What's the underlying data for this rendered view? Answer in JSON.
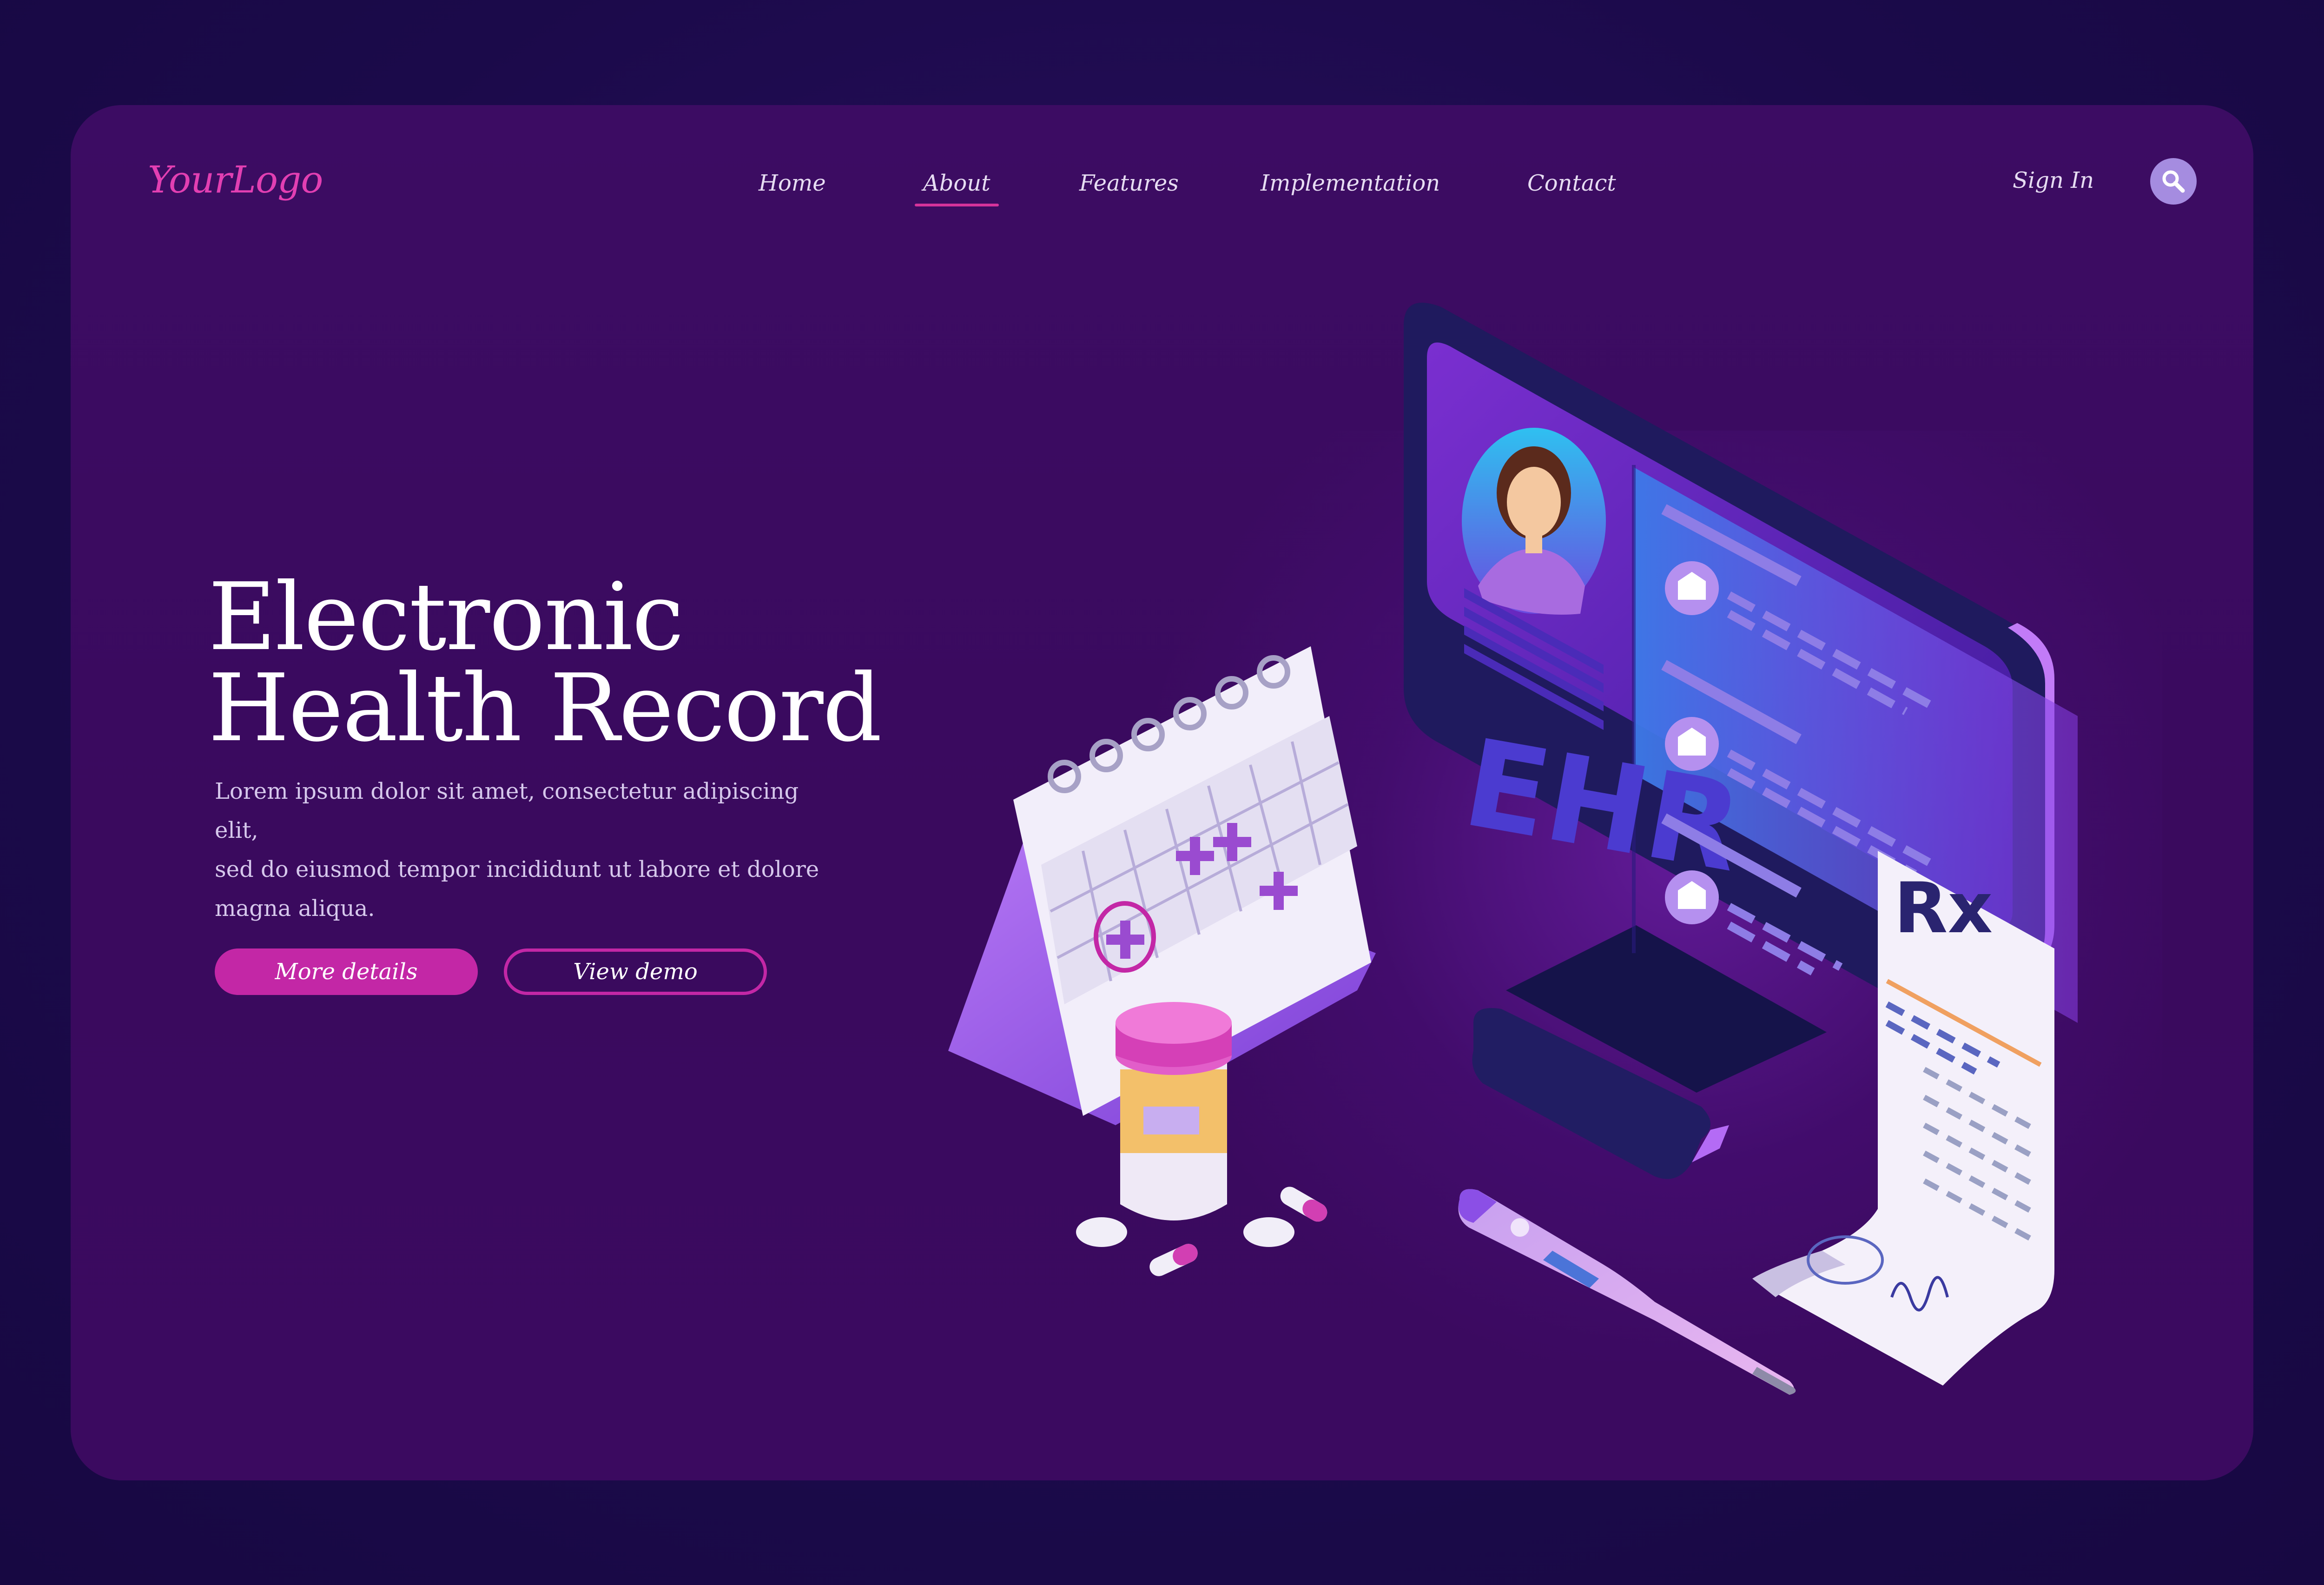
{
  "header": {
    "logo": "YourLogo",
    "nav": [
      {
        "label": "Home"
      },
      {
        "label": "About",
        "active": true
      },
      {
        "label": "Features"
      },
      {
        "label": "Implementation"
      },
      {
        "label": "Contact"
      }
    ],
    "sign_in": "Sign In",
    "search_icon": "search-icon"
  },
  "hero": {
    "title_line1": "Electronic",
    "title_line2": "Health Record",
    "description_lines": [
      "Lorem ipsum dolor sit amet, consectetur adipiscing elit,",
      "sed do eiusmod tempor incididunt ut labore et dolore",
      "magna aliqua."
    ],
    "primary_button": "More details",
    "secondary_button": "View demo"
  },
  "illustration": {
    "monitor_text": "EHR",
    "prescription_symbol": "Rx"
  },
  "colors": {
    "background": "#1b0a4a",
    "card": "#3c0c63",
    "accent": "#c327a6",
    "logo": "#e23fb2",
    "search_button": "#a58ce0"
  }
}
